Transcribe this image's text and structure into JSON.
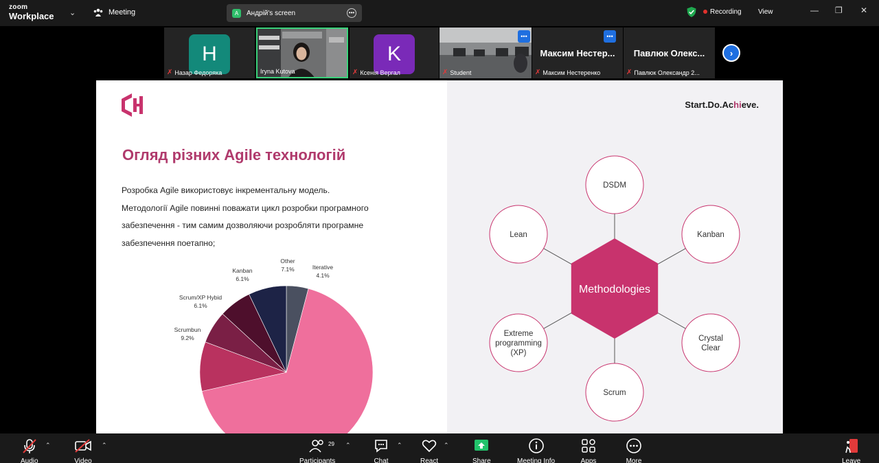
{
  "titlebar": {
    "brand_top": "zoom",
    "brand_bottom": "Workplace",
    "meeting_label": "Meeting",
    "screen_badge": "A",
    "screen_label": "Андрій's screen",
    "recording_label": "Recording",
    "view_label": "View"
  },
  "participants": [
    {
      "name": "Назар Федоряка",
      "initial": "H",
      "avatar_color": "#13897a"
    },
    {
      "name": "Iryna Kutova"
    },
    {
      "name": "Ксенія Вергал",
      "initial": "K",
      "avatar_color": "#7a2ab8"
    },
    {
      "name": "Student"
    },
    {
      "name": "Максим Нестеренко",
      "display": "Максим Нестер..."
    },
    {
      "name": "Павлюк Олександр 2...",
      "display": "Павлюк Олекс..."
    }
  ],
  "slide": {
    "slogan_start": "Start.Do.Ac",
    "slogan_hl": "hi",
    "slogan_end": "eve.",
    "title": "Огляд різних Agile технологій",
    "body": [
      "Розробка Agile використовує інкрементальну модель.",
      "Методології Agile повинні поважати цикл розробки програмного",
      "забезпечення - тим самим дозволяючи розробляти програмне",
      "забезпечення поетапно;"
    ],
    "accent_color": "#c8336d"
  },
  "chart_data": {
    "type": "pie",
    "slices": [
      {
        "label": "Iterative",
        "pct_label": "4.1%",
        "value": 4.1,
        "color": "#4a5060"
      },
      {
        "label": "",
        "pct_label": "",
        "value": 67.4,
        "color": "#ef6f9c"
      },
      {
        "label": "Scrumbun",
        "pct_label": "9.2%",
        "value": 9.2,
        "color": "#b9325f"
      },
      {
        "label": "Scrum/XP Hybid",
        "pct_label": "6.1%",
        "value": 6.1,
        "color": "#7a1f45"
      },
      {
        "label": "Kanban",
        "pct_label": "6.1%",
        "value": 6.1,
        "color": "#4e0f2c"
      },
      {
        "label": "Other",
        "pct_label": "7.1%",
        "value": 7.1,
        "color": "#1d2346"
      }
    ]
  },
  "diagram": {
    "center": "Methodologies",
    "nodes": [
      "DSDM",
      "Kanban",
      "Crystal Clear",
      "Scrum",
      "Extreme programming (XP)",
      "Lean"
    ]
  },
  "toolbar": {
    "audio": "Audio",
    "video": "Video",
    "participants": "Participants",
    "participants_count": "29",
    "chat": "Chat",
    "react": "React",
    "share": "Share",
    "meeting_info": "Meeting Info",
    "apps": "Apps",
    "more": "More",
    "leave": "Leave"
  }
}
